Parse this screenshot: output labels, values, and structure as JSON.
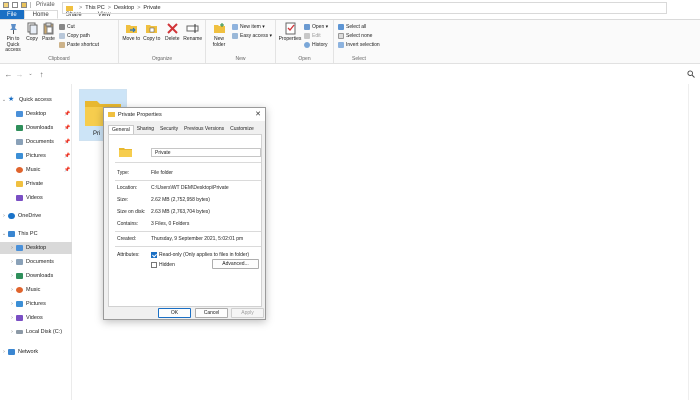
{
  "window": {
    "title": "Private"
  },
  "ribbon": {
    "tabs": {
      "file": "File",
      "home": "Home",
      "share": "Share",
      "view": "View"
    },
    "clipboard": {
      "label": "Clipboard",
      "pin": "Pin to Quick access",
      "copy": "Copy",
      "paste": "Paste",
      "cut": "Cut",
      "copy_path": "Copy path",
      "paste_shortcut": "Paste shortcut"
    },
    "organize": {
      "label": "Organize",
      "move_to": "Move to",
      "copy_to": "Copy to",
      "delete": "Delete",
      "rename": "Rename"
    },
    "new": {
      "label": "New",
      "new_folder": "New folder",
      "new_item": "New item",
      "easy_access": "Easy access"
    },
    "open": {
      "label": "Open",
      "properties": "Properties",
      "open": "Open",
      "edit": "Edit",
      "history": "History"
    },
    "select": {
      "label": "Select",
      "select_all": "Select all",
      "select_none": "Select none",
      "invert": "Invert selection"
    }
  },
  "address": {
    "crumbs": [
      "This PC",
      "Desktop",
      "Private"
    ],
    "sep": ">"
  },
  "nav": {
    "quick_access": "Quick access",
    "desktop": "Desktop",
    "downloads": "Downloads",
    "documents": "Documents",
    "pictures": "Pictures",
    "music": "Music",
    "private": "Private",
    "videos": "Videos",
    "onedrive": "OneDrive",
    "this_pc": "This PC",
    "pc_desktop": "Desktop",
    "pc_documents": "Documents",
    "pc_downloads": "Downloads",
    "pc_music": "Music",
    "pc_pictures": "Pictures",
    "pc_videos": "Videos",
    "local_disk": "Local Disk (C:)",
    "network": "Network"
  },
  "content": {
    "folder_label": "Pri"
  },
  "dialog": {
    "title": "Private Properties",
    "tabs": [
      "General",
      "Sharing",
      "Security",
      "Previous Versions",
      "Customize"
    ],
    "name": "Private",
    "type_label": "Type:",
    "type_value": "File folder",
    "location_label": "Location:",
    "location_value": "C:\\Users\\WT DEM\\Desktop\\Private",
    "size_label": "Size:",
    "size_value": "2.62 MB (2,752,958 bytes)",
    "size_on_disk_label": "Size on disk:",
    "size_on_disk_value": "2.63 MB (2,763,704 bytes)",
    "contains_label": "Contains:",
    "contains_value": "3 Files, 0 Folders",
    "created_label": "Created:",
    "created_value": "Thursday, 9 September 2021, 5:02:01 pm",
    "attributes_label": "Attributes:",
    "readonly_label": "Read-only (Only applies to files in folder)",
    "hidden_label": "Hidden",
    "advanced": "Advanced...",
    "ok": "OK",
    "cancel": "Cancel",
    "apply": "Apply"
  },
  "colors": {
    "accent": "#1a6fc4",
    "folder": "#f0c040",
    "selection": "#cce4f7"
  }
}
